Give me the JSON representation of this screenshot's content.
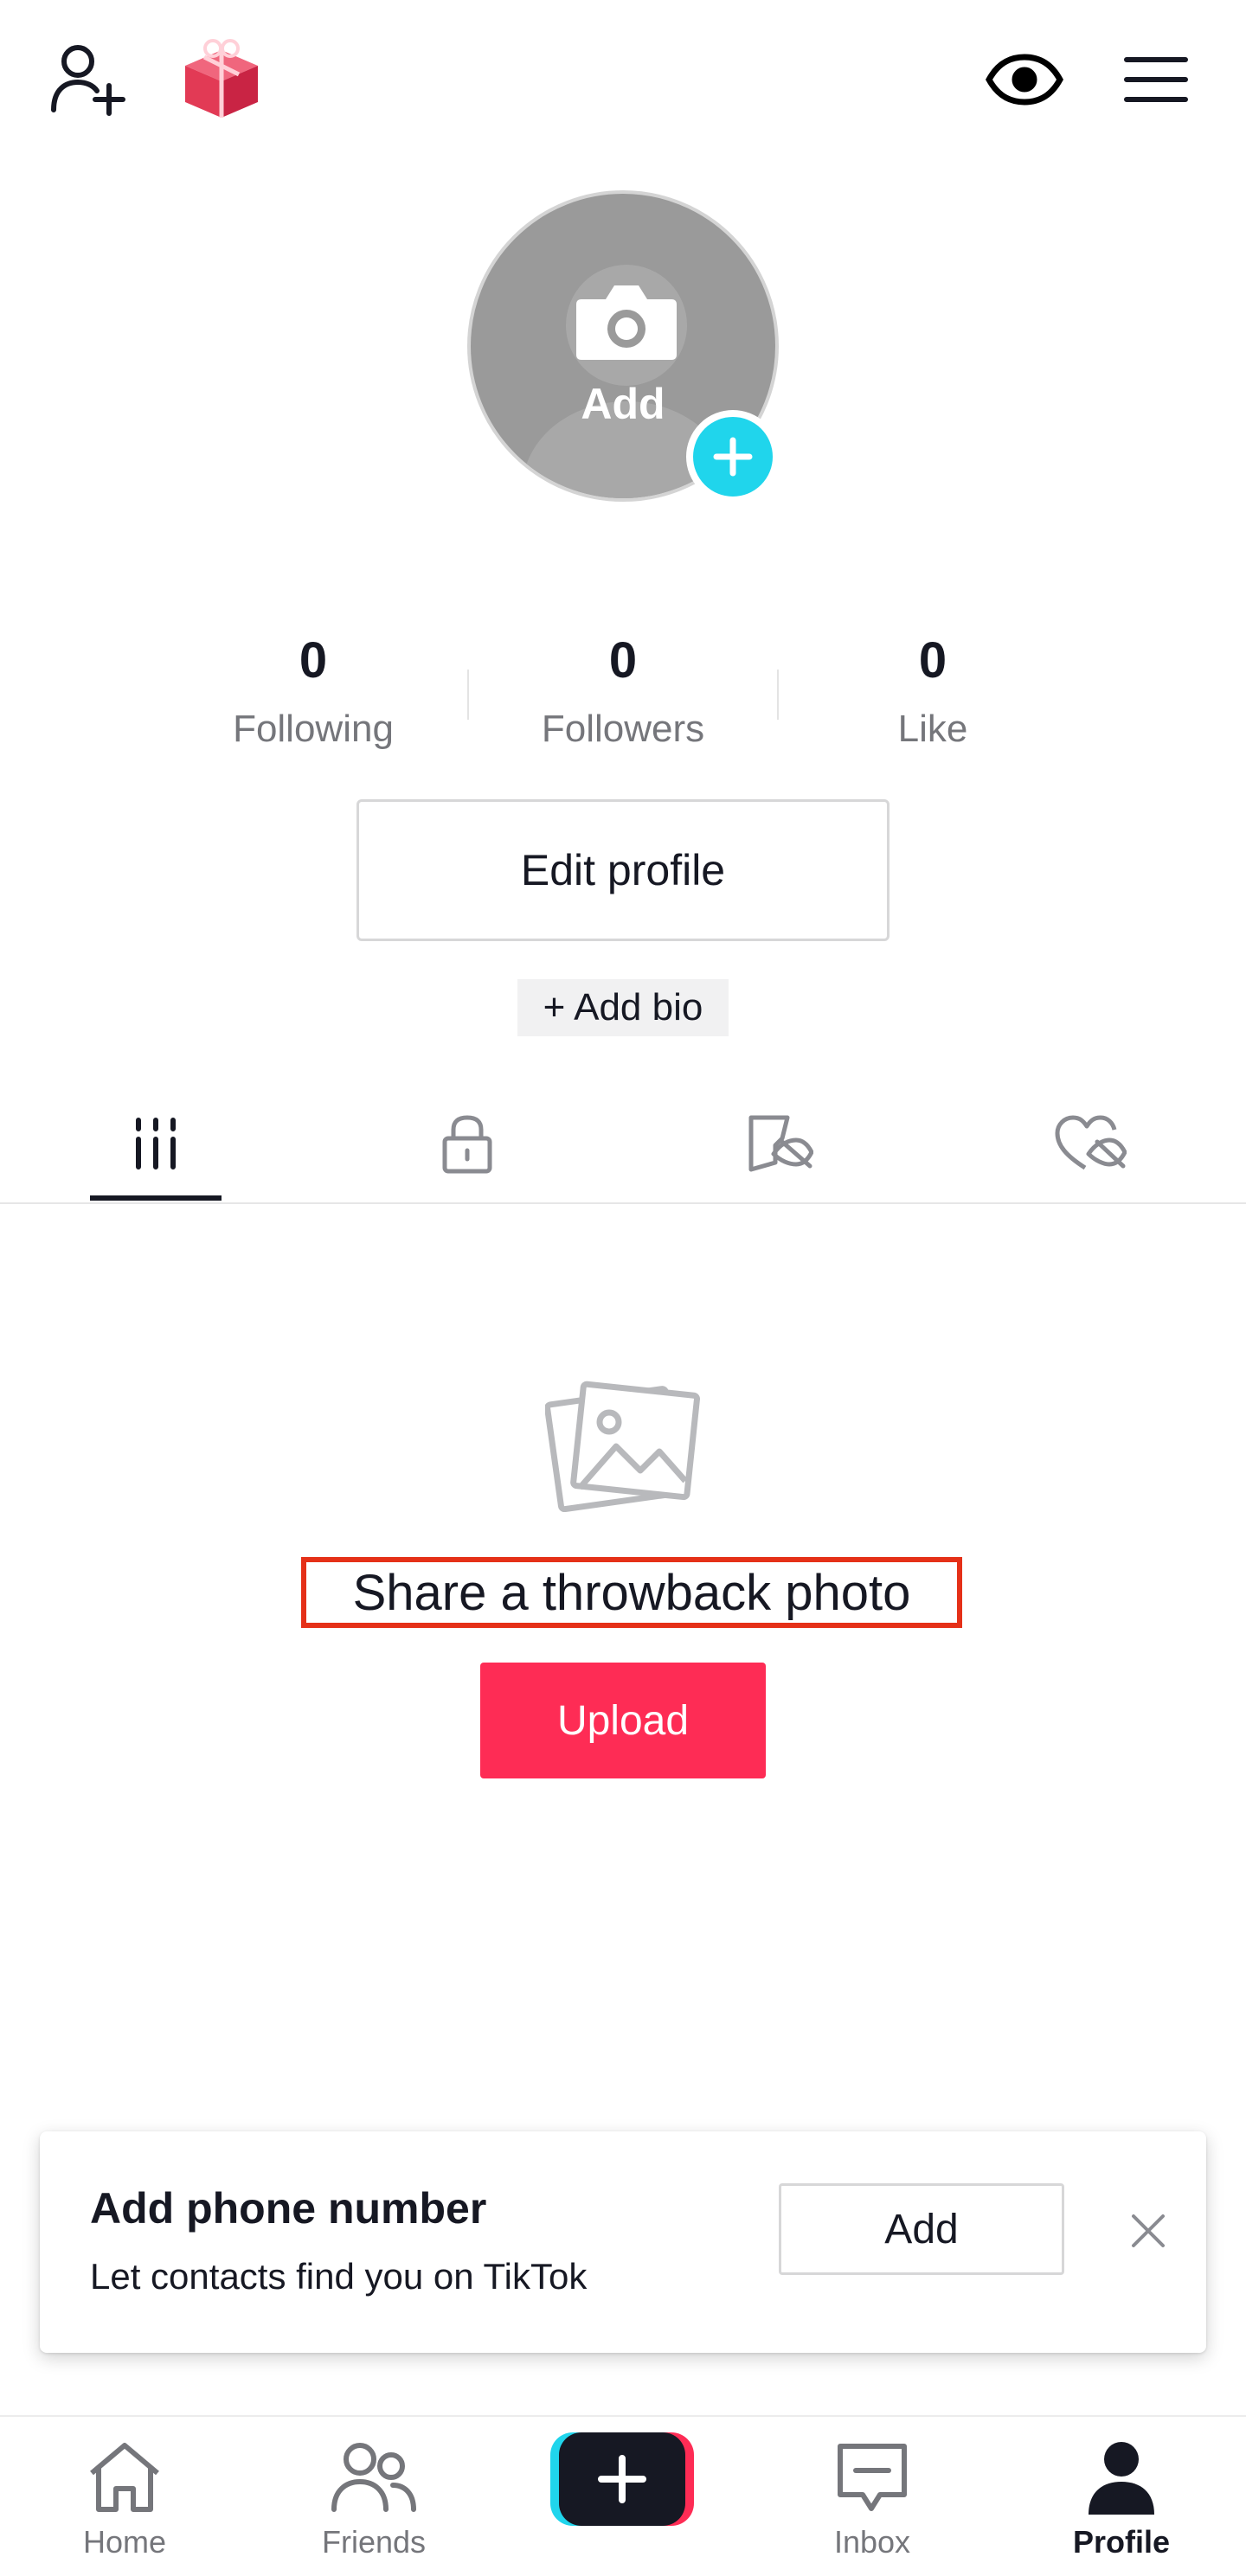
{
  "avatar": {
    "add_label": "Add"
  },
  "stats": [
    {
      "value": "0",
      "label": "Following"
    },
    {
      "value": "0",
      "label": "Followers"
    },
    {
      "value": "0",
      "label": "Like"
    }
  ],
  "profile": {
    "edit_label": "Edit profile",
    "add_bio_label": "+ Add bio"
  },
  "empty_state": {
    "message": "Share a throwback photo",
    "upload_label": "Upload"
  },
  "phone_prompt": {
    "title": "Add phone number",
    "subtitle": "Let contacts find you on TikTok",
    "add_label": "Add"
  },
  "nav": [
    {
      "label": "Home"
    },
    {
      "label": "Friends"
    },
    {
      "label": "Inbox"
    },
    {
      "label": "Profile"
    }
  ],
  "colors": {
    "accent": "#fe2c55",
    "teal": "#20d5ec",
    "text": "#161823",
    "muted": "#75767b"
  }
}
